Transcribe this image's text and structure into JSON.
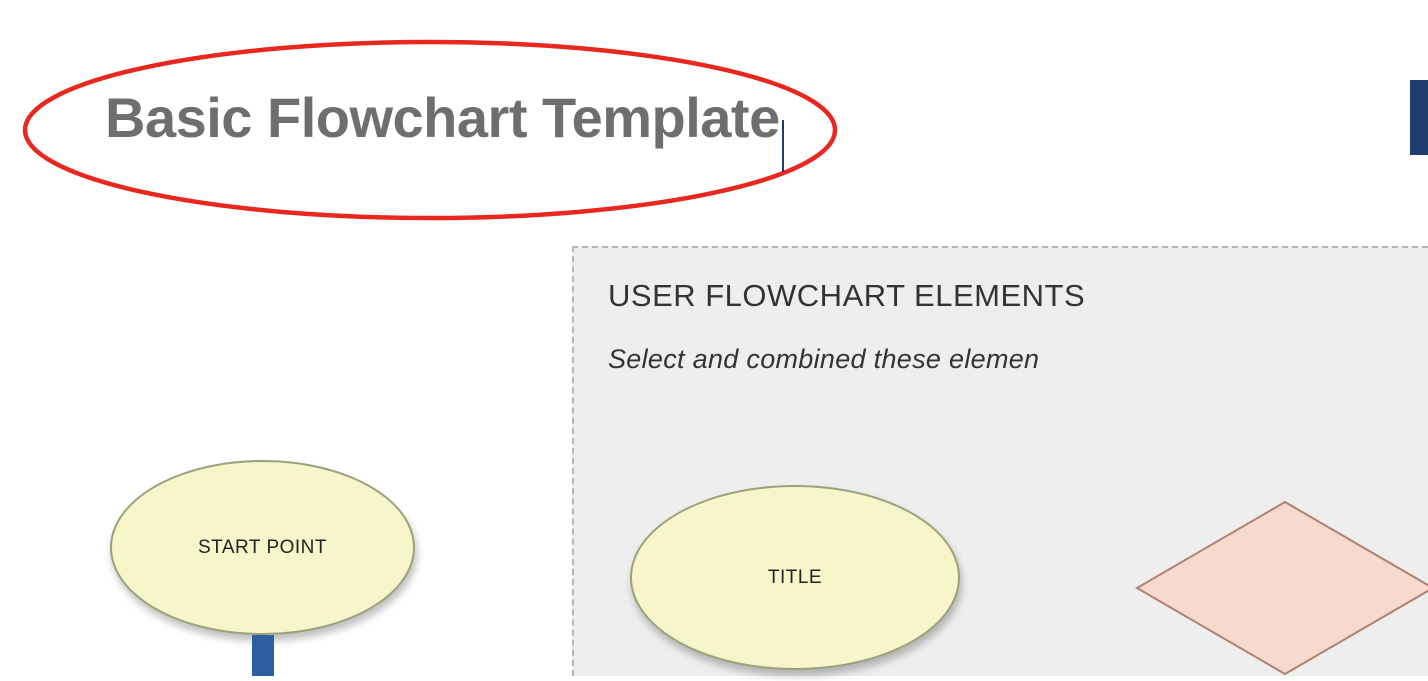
{
  "title": "Basic Flowchart Template",
  "shapes": {
    "start_point": "START POINT",
    "title_shape": "TITLE"
  },
  "panel": {
    "heading": "USER FLOWCHART ELEMENTS",
    "subtitle": "Select and combined these elemen"
  }
}
